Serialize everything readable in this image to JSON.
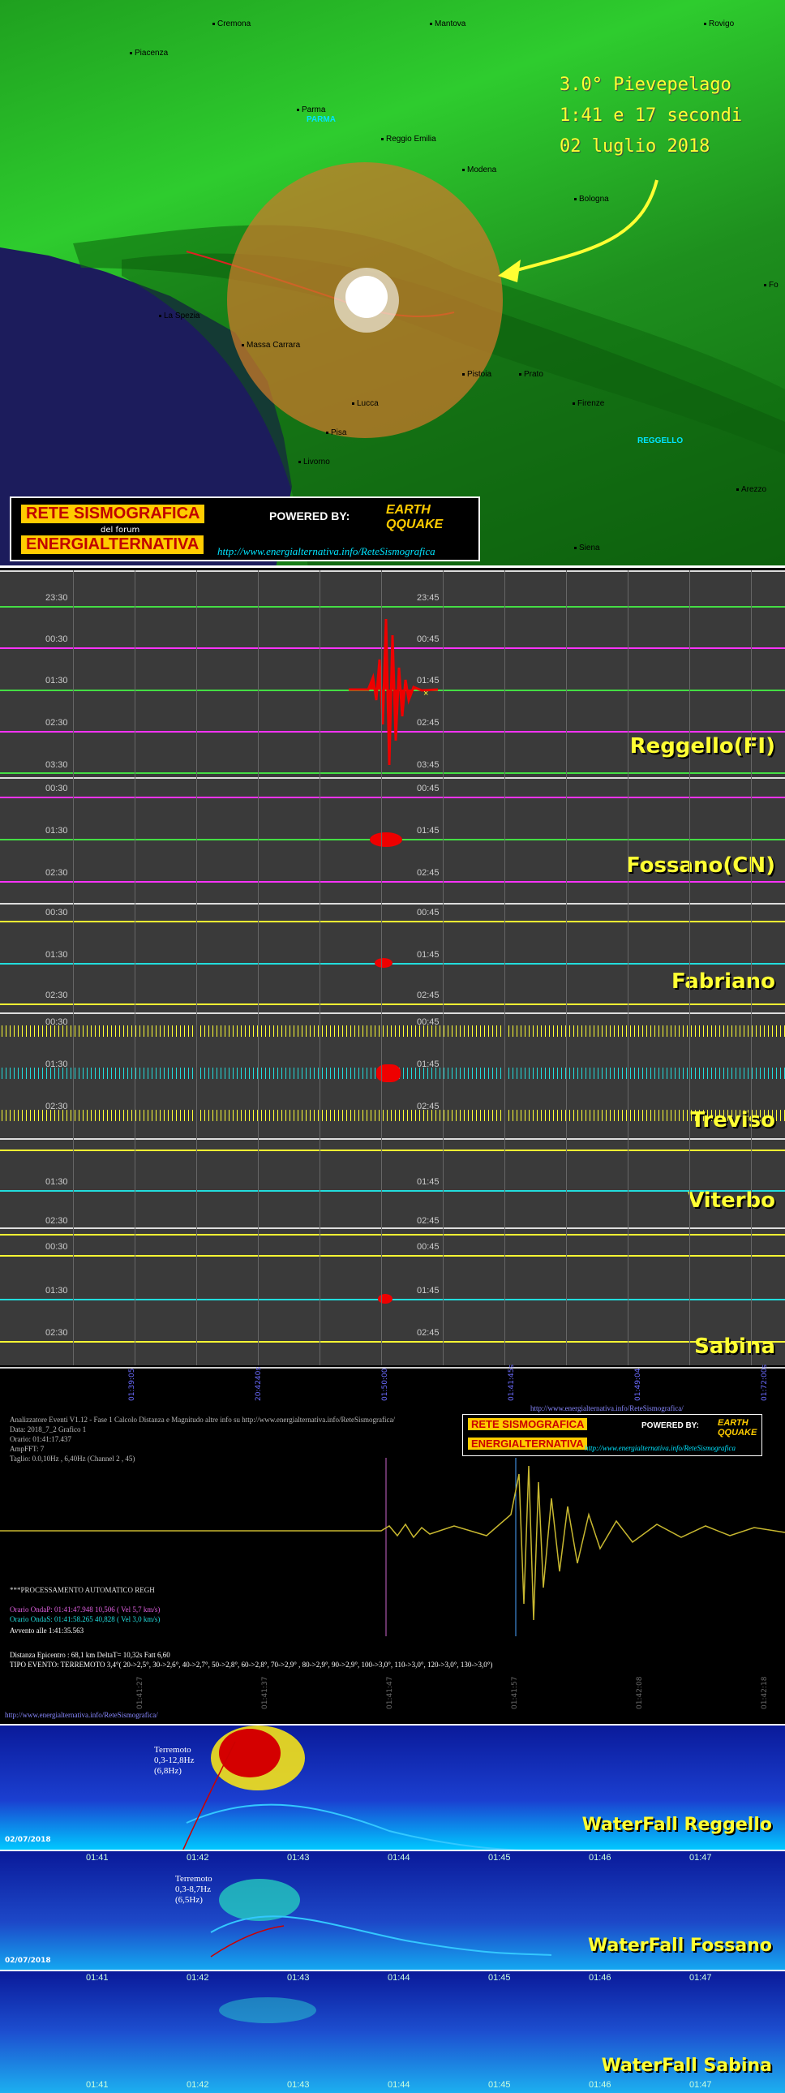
{
  "map": {
    "event_line1": "3.0° Pievepelago",
    "event_line2": "1:41 e 17 secondi",
    "event_line3": "02 luglio 2018",
    "cities": [
      "Cremona",
      "Mantova",
      "Rovigo",
      "Piacenza",
      "Parma",
      "PARMA",
      "Reggio Emilia",
      "Modena",
      "Bologna",
      "La Spezia",
      "Massa Carrara",
      "Pistoia",
      "Prato",
      "Fo",
      "Lucca",
      "Firenze",
      "REGGELLO",
      "Pisa",
      "Livorno",
      "Arezzo",
      "Siena"
    ],
    "colors": {
      "land": "#1fa01f",
      "sea": "#1a1a5a",
      "circle": "#c87a2a",
      "event_text": "#ffff33"
    }
  },
  "logo": {
    "line1": "RETE SISMOGRAFICA",
    "line2": "del forum",
    "line3": "ENERGIALTERNATIVA",
    "powered": "POWERED BY:",
    "brand_top": "EARTH",
    "brand_bottom": "QQUAKE",
    "url": "http://www.energialternativa.info/ReteSismografica"
  },
  "stations": {
    "reggello": {
      "name": "Reggello(FI)",
      "left_times": [
        "23:30",
        "00:30",
        "01:30",
        "02:30",
        "03:30"
      ],
      "right_times": [
        "23:45",
        "00:45",
        "01:45",
        "02:45",
        "03:45"
      ]
    },
    "fossano": {
      "name": "Fossano(CN)",
      "left_times": [
        "00:30",
        "01:30",
        "02:30"
      ],
      "right_times": [
        "00:45",
        "01:45",
        "02:45"
      ]
    },
    "fabriano": {
      "name": "Fabriano",
      "left_times": [
        "00:30",
        "01:30",
        "02:30"
      ],
      "right_times": [
        "00:45",
        "01:45",
        "02:45"
      ]
    },
    "treviso": {
      "name": "Treviso",
      "left_times": [
        "00:30",
        "01:30",
        "02:30"
      ],
      "right_times": [
        "00:45",
        "01:45",
        "02:45"
      ]
    },
    "viterbo": {
      "name": "Viterbo",
      "left_times": [
        "01:30",
        "02:30"
      ],
      "right_times": [
        "01:45",
        "02:45"
      ]
    },
    "sabina": {
      "name": "Sabina",
      "left_times": [
        "00:30",
        "01:30",
        "02:30"
      ],
      "right_times": [
        "00:45",
        "01:45",
        "02:45"
      ]
    }
  },
  "analysis": {
    "url_top": "http://www.energialternativa.info/ReteSismografica/",
    "header1": "Analizzatore Eventi V1.12 - Fase 1 Calcolo Distanza e Magnitudo altre info su http://www.energialternativa.info/ReteSismografica/",
    "header2": "Data: 2018_7_2 Grafico 1",
    "header3": "Orario: 01:41:17.437",
    "header4": "AmpFFT: 7",
    "header5": "Taglio: 0.0,10Hz , 6,40Hz     (Channel 2 , 45)",
    "proc": "***PROCESSAMENTO AUTOMATICO REGH",
    "onda_p": "Orario OndaP: 01:41:47.948  10,506 ( Vel 5,7 km/s)",
    "onda_s": "Orario OndaS: 01:41:58.265  40,828 ( Vel 3,0 km/s)",
    "avvento": "Avvento alle 1:41:35.563",
    "distanza": "Distanza Epicentro : 68,1 km DeltaT= 10,32s  Fatt 6,60",
    "tipo": "TIPO EVENTO: TERREMOTO 3,4°( 20->2,5°, 30->2,6°, 40->2,7°, 50->2,8°, 60->2,8°, 70->2,9° , 80->2,9°, 90->2,9°, 100->3,0°, 110->3,0°, 120->3,0°, 130->3,0°)",
    "url_bottom": "http://www.energialternativa.info/ReteSismografica/",
    "top_ticks": [
      "01:39:05",
      "20:4240s",
      "01:50:00",
      "01:41:45s",
      "01:49:04",
      "01:72:00s"
    ],
    "bottom_ticks": [
      "01:41:27",
      "01:41:37",
      "01:41:47",
      "01:41:57",
      "01:42:08",
      "01:42:18"
    ]
  },
  "waterfalls": [
    {
      "name": "WaterFall Reggello",
      "date": "02/07/2018",
      "annotation": [
        "Terremoto",
        "0,3-12,8Hz",
        "(6,8Hz)"
      ]
    },
    {
      "name": "WaterFall Fossano",
      "date": "02/07/2018",
      "annotation": [
        "Terremoto",
        "0,3-8,7Hz",
        "(6,5Hz)"
      ]
    },
    {
      "name": "WaterFall Sabina",
      "date": "02/07/2018",
      "annotation": []
    }
  ],
  "wf_ticks": [
    "01:41",
    "01:42",
    "01:43",
    "01:44",
    "01:45",
    "01:46",
    "01:47"
  ]
}
